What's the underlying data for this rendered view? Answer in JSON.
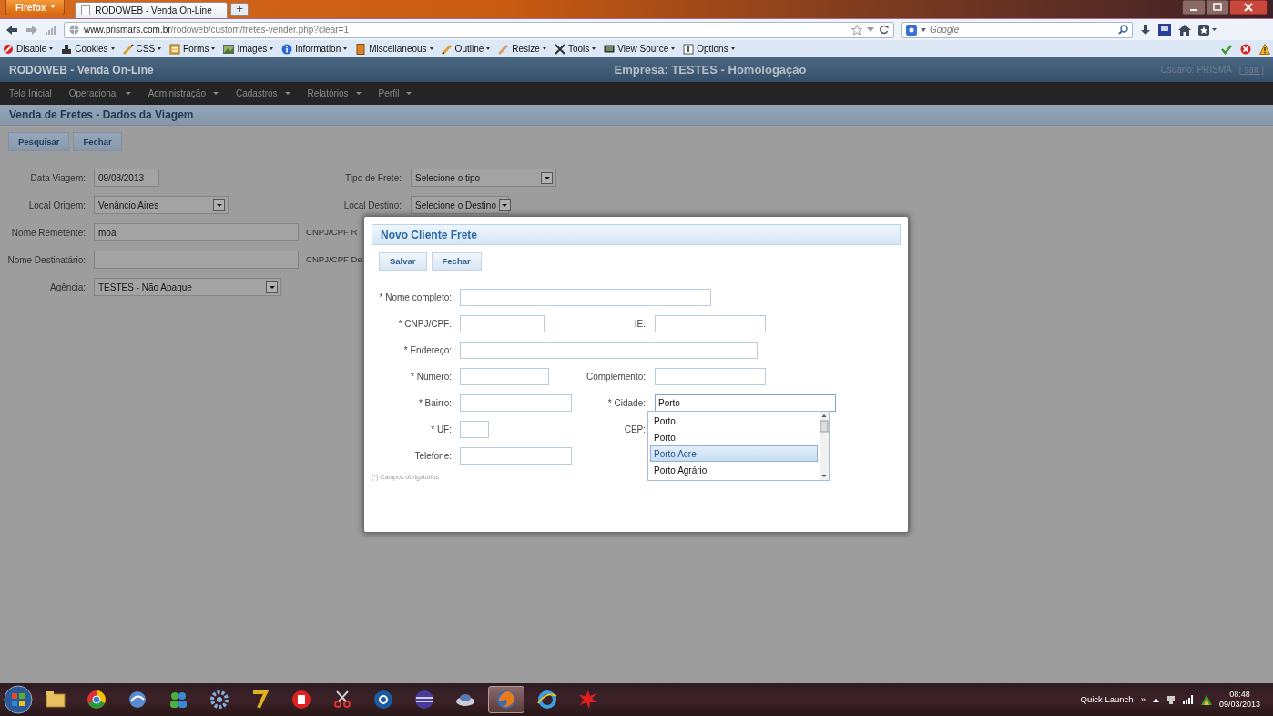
{
  "browser": {
    "menu_button": "Firefox",
    "tabs": [
      {
        "label": "RODOWEB - Venda On-Line",
        "selected": true
      }
    ],
    "new_tab": "+",
    "url": {
      "domain": "www.prismars.com.br",
      "path": "/rodoweb/custom/fretes-vender.php?clear=1"
    },
    "search": {
      "placeholder": "Google"
    }
  },
  "dev_toolbar": [
    {
      "label": "Disable"
    },
    {
      "label": "Cookies"
    },
    {
      "label": "CSS"
    },
    {
      "label": "Forms"
    },
    {
      "label": "Images"
    },
    {
      "label": "Information"
    },
    {
      "label": "Miscellaneous"
    },
    {
      "label": "Outline"
    },
    {
      "label": "Resize"
    },
    {
      "label": "Tools"
    },
    {
      "label": "View Source"
    },
    {
      "label": "Options"
    }
  ],
  "app": {
    "title": "RODOWEB - Venda On-Line",
    "company": "Empresa: TESTES - Homologação",
    "user": "Usuário: PRISMA",
    "logout": "[ sair ]"
  },
  "menu": [
    {
      "label": "Tela Inicial",
      "has_submenu": false
    },
    {
      "label": "Operacional",
      "has_submenu": true
    },
    {
      "label": "Administração",
      "has_submenu": true
    },
    {
      "label": "Cadastros",
      "has_submenu": true
    },
    {
      "label": "Relatórios",
      "has_submenu": true
    },
    {
      "label": "Perfil",
      "has_submenu": true
    }
  ],
  "page": {
    "title": "Venda de Fretes - Dados da Viagem",
    "buttons": [
      "Pesquisar",
      "Fechar"
    ],
    "rows": [
      [
        {
          "label": "Data Viagem:",
          "kind": "text",
          "value": "09/03/2013"
        },
        {
          "label": "Tipo de Frete:",
          "kind": "select",
          "value": "Selecione o tipo"
        }
      ],
      [
        {
          "label": "Local Origem:",
          "kind": "select",
          "value": "Venâncio Aires"
        },
        {
          "label": "Local Destino:",
          "kind": "select",
          "value": "Selecione o Destino"
        }
      ],
      [
        {
          "label": "Nome Remetente:",
          "kind": "text",
          "value": "moa"
        },
        {
          "label": "CNPJ/CPF R",
          "kind": "label"
        }
      ],
      [
        {
          "label": "Nome Destinatário:",
          "kind": "text"
        },
        {
          "label": "CNPJ/CPF De",
          "kind": "label"
        }
      ],
      [
        {
          "label": "Agência:",
          "kind": "select",
          "value": "TESTES - Não Apague"
        }
      ]
    ]
  },
  "modal": {
    "title": "Novo Cliente Frete",
    "buttons": [
      "Salvar",
      "Fechar"
    ],
    "rows": [
      [
        {
          "label": "* Nome completo:",
          "kind": "text"
        }
      ],
      [
        {
          "label": "* CNPJ/CPF:",
          "kind": "text"
        },
        {
          "label": "IE:",
          "kind": "text"
        }
      ],
      [
        {
          "label": "* Endereço:",
          "kind": "text"
        }
      ],
      [
        {
          "label": "* Número:",
          "kind": "text"
        },
        {
          "label": "Complemento:",
          "kind": "text"
        }
      ],
      [
        {
          "label": "* Bairro:",
          "kind": "text"
        },
        {
          "label": "* Cidade:",
          "kind": "text",
          "value": "Porto",
          "focused": true
        }
      ],
      [
        {
          "label": "* UF:",
          "kind": "text"
        },
        {
          "label": "CEP:",
          "kind": "label"
        }
      ],
      [
        {
          "label": "Telefone:",
          "kind": "text"
        }
      ]
    ],
    "footnote": "(*) Campos obrigatórios",
    "suggestions": [
      {
        "label": "Porto",
        "selected": false
      },
      {
        "label": "Porto",
        "selected": false
      },
      {
        "label": "Porto Acre",
        "selected": true
      },
      {
        "label": "Porto Agrário",
        "selected": false
      }
    ]
  },
  "taskbar": {
    "apps": [
      {
        "selected": false
      },
      {
        "selected": false
      },
      {
        "selected": false
      },
      {
        "selected": false
      },
      {
        "selected": false
      },
      {
        "selected": false
      },
      {
        "selected": false
      },
      {
        "selected": false
      },
      {
        "selected": false
      },
      {
        "selected": false
      },
      {
        "selected": false
      },
      {
        "selected": true
      },
      {
        "selected": false
      },
      {
        "selected": false
      }
    ],
    "quick_launch": "Quick Launch",
    "chevron": "»",
    "time": "08:48",
    "date": "09/03/2013"
  }
}
